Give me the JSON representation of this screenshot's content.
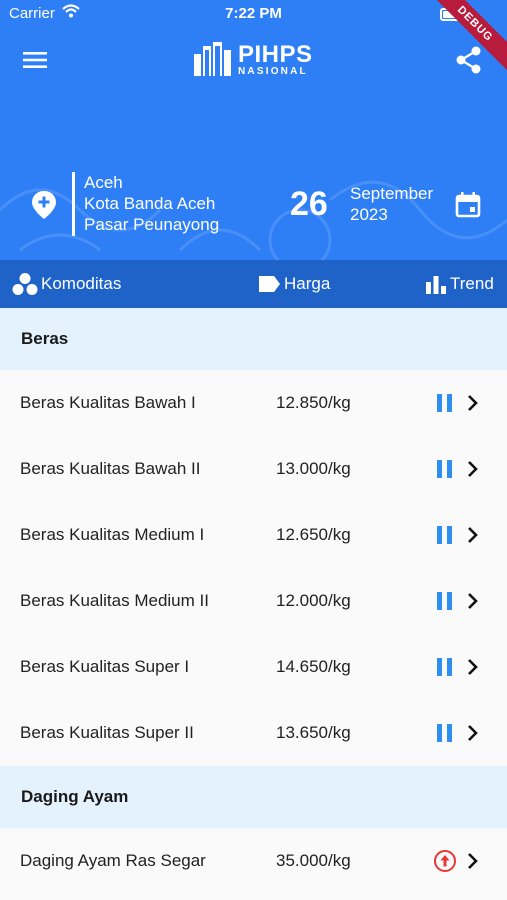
{
  "status_bar": {
    "carrier": "Carrier",
    "time": "7:22 PM"
  },
  "debug_banner": "DEBUG",
  "app": {
    "logo_title": "PIHPS",
    "logo_subtitle": "NASIONAL"
  },
  "location": {
    "province": "Aceh",
    "city": "Kota Banda Aceh",
    "market": "Pasar Peunayong"
  },
  "date": {
    "day": "26",
    "month": "September",
    "year": "2023"
  },
  "tabs": [
    {
      "label": "Komoditas",
      "icon": "komoditas-icon"
    },
    {
      "label": "Harga",
      "icon": "tag-icon"
    },
    {
      "label": "Trend",
      "icon": "bar-chart-icon"
    }
  ],
  "colors": {
    "primary": "#2e7ff6",
    "tabbar": "#1f63c9",
    "section_bg": "#e3f2fd",
    "stable": "#2e8ff0",
    "up": "#e53935"
  },
  "sections": [
    {
      "title": "Beras",
      "items": [
        {
          "name": "Beras Kualitas Bawah I",
          "price": "12.850/kg",
          "status": "stable"
        },
        {
          "name": "Beras Kualitas Bawah II",
          "price": "13.000/kg",
          "status": "stable"
        },
        {
          "name": "Beras Kualitas Medium I",
          "price": "12.650/kg",
          "status": "stable"
        },
        {
          "name": "Beras Kualitas Medium II",
          "price": "12.000/kg",
          "status": "stable"
        },
        {
          "name": "Beras Kualitas Super I",
          "price": "14.650/kg",
          "status": "stable"
        },
        {
          "name": "Beras Kualitas Super II",
          "price": "13.650/kg",
          "status": "stable"
        }
      ]
    },
    {
      "title": "Daging Ayam",
      "items": [
        {
          "name": "Daging Ayam Ras Segar",
          "price": "35.000/kg",
          "status": "up"
        }
      ]
    }
  ]
}
